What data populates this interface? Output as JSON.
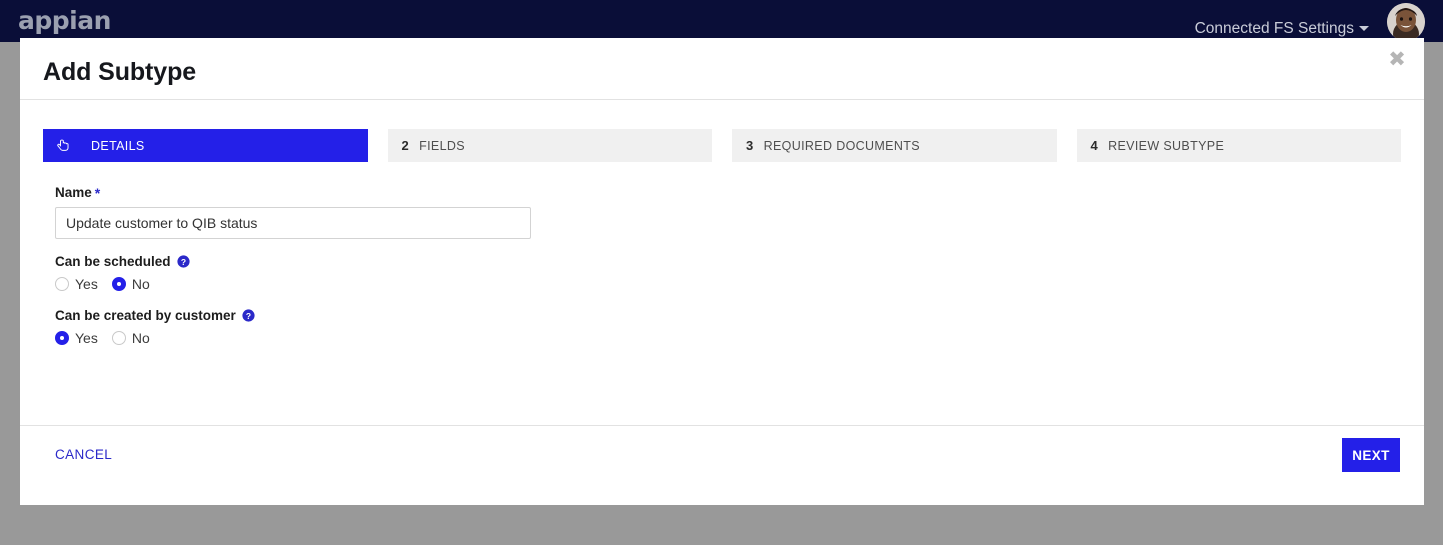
{
  "app_bar": {
    "brand": "appian",
    "user_menu_label": "Connected FS Settings",
    "caret_icon": "chevron-down-icon",
    "avatar_icon": "user-avatar"
  },
  "modal": {
    "title": "Add Subtype",
    "close_label": "✖",
    "close_icon": "close-icon",
    "steps": [
      {
        "num": "",
        "icon": "pointer-hand-icon",
        "label": "DETAILS",
        "active": true
      },
      {
        "num": "2",
        "icon": "",
        "label": "FIELDS",
        "active": false
      },
      {
        "num": "3",
        "icon": "",
        "label": "REQUIRED DOCUMENTS",
        "active": false
      },
      {
        "num": "4",
        "icon": "",
        "label": "REVIEW SUBTYPE",
        "active": false
      }
    ],
    "form": {
      "name": {
        "label": "Name",
        "required_marker": "*",
        "value": "Update customer to QIB status",
        "placeholder": ""
      },
      "can_be_scheduled": {
        "label": "Can be scheduled",
        "help_icon": "help-circle-icon",
        "options": [
          {
            "label": "Yes",
            "selected": false
          },
          {
            "label": "No",
            "selected": true
          }
        ]
      },
      "can_be_created_by_customer": {
        "label": "Can be created by customer",
        "help_icon": "help-circle-icon",
        "options": [
          {
            "label": "Yes",
            "selected": true
          },
          {
            "label": "No",
            "selected": false
          }
        ]
      }
    },
    "footer": {
      "cancel_label": "CANCEL",
      "next_label": "NEXT"
    }
  },
  "colors": {
    "app_bar_bg": "#0a0e38",
    "accent_blue": "#2420e8",
    "link_blue": "#2b29c9",
    "overlay_gray": "#999999",
    "step_inactive_bg": "#f0f0f0"
  }
}
